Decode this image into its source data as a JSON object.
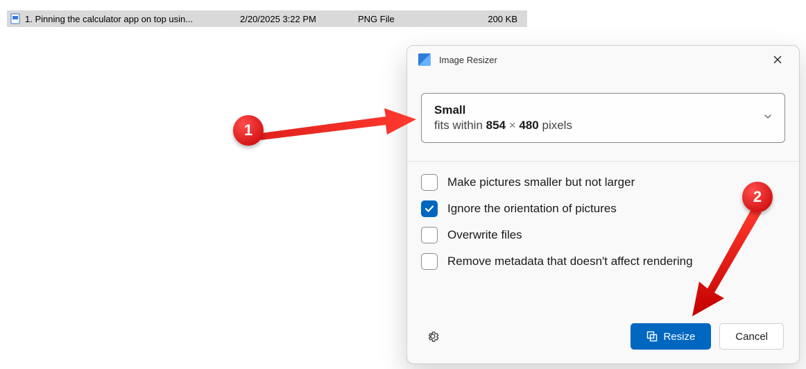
{
  "file_row": {
    "name": "1. Pinning the calculator app on top usin...",
    "date": "2/20/2025 3:22 PM",
    "type": "PNG File",
    "size": "200 KB"
  },
  "dialog": {
    "title": "Image Resizer",
    "size_select": {
      "name": "Small",
      "desc_prefix": "fits within ",
      "width": "854",
      "times": " × ",
      "height": "480",
      "desc_suffix": " pixels"
    },
    "options": [
      {
        "label": "Make pictures smaller but not larger",
        "checked": false
      },
      {
        "label": "Ignore the orientation of pictures",
        "checked": true
      },
      {
        "label": "Overwrite files",
        "checked": false
      },
      {
        "label": "Remove metadata that doesn't affect rendering",
        "checked": false
      }
    ],
    "buttons": {
      "primary": "Resize",
      "secondary": "Cancel"
    }
  },
  "annotations": {
    "marker1": "1",
    "marker2": "2"
  }
}
